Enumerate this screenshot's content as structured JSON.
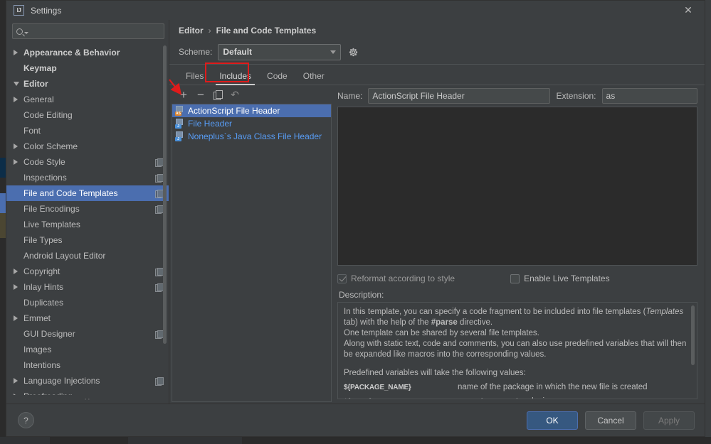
{
  "window": {
    "title": "Settings",
    "app_icon": "intellij-idea-icon",
    "close_icon": "close-icon"
  },
  "sidebar": {
    "search": {
      "placeholder": "",
      "value": "",
      "icon": "search-icon"
    },
    "items": [
      {
        "label": "Appearance & Behavior",
        "arrow": "collapsed",
        "bold": true,
        "indent": 0,
        "selected": false,
        "copy": false
      },
      {
        "label": "Keymap",
        "arrow": "none",
        "bold": true,
        "indent": 0,
        "selected": false,
        "copy": false
      },
      {
        "label": "Editor",
        "arrow": "expanded",
        "bold": true,
        "indent": 0,
        "selected": false,
        "copy": false
      },
      {
        "label": "General",
        "arrow": "collapsed",
        "bold": false,
        "indent": 1,
        "selected": false,
        "copy": false
      },
      {
        "label": "Code Editing",
        "arrow": "none",
        "bold": false,
        "indent": 1,
        "selected": false,
        "copy": false
      },
      {
        "label": "Font",
        "arrow": "none",
        "bold": false,
        "indent": 1,
        "selected": false,
        "copy": false
      },
      {
        "label": "Color Scheme",
        "arrow": "collapsed",
        "bold": false,
        "indent": 1,
        "selected": false,
        "copy": false
      },
      {
        "label": "Code Style",
        "arrow": "collapsed",
        "bold": false,
        "indent": 1,
        "selected": false,
        "copy": true
      },
      {
        "label": "Inspections",
        "arrow": "none",
        "bold": false,
        "indent": 1,
        "selected": false,
        "copy": true
      },
      {
        "label": "File and Code Templates",
        "arrow": "none",
        "bold": false,
        "indent": 1,
        "selected": true,
        "copy": true
      },
      {
        "label": "File Encodings",
        "arrow": "none",
        "bold": false,
        "indent": 1,
        "selected": false,
        "copy": true
      },
      {
        "label": "Live Templates",
        "arrow": "none",
        "bold": false,
        "indent": 1,
        "selected": false,
        "copy": false
      },
      {
        "label": "File Types",
        "arrow": "none",
        "bold": false,
        "indent": 1,
        "selected": false,
        "copy": false
      },
      {
        "label": "Android Layout Editor",
        "arrow": "none",
        "bold": false,
        "indent": 1,
        "selected": false,
        "copy": false
      },
      {
        "label": "Copyright",
        "arrow": "collapsed",
        "bold": false,
        "indent": 1,
        "selected": false,
        "copy": true
      },
      {
        "label": "Inlay Hints",
        "arrow": "collapsed",
        "bold": false,
        "indent": 1,
        "selected": false,
        "copy": true
      },
      {
        "label": "Duplicates",
        "arrow": "none",
        "bold": false,
        "indent": 1,
        "selected": false,
        "copy": false
      },
      {
        "label": "Emmet",
        "arrow": "collapsed",
        "bold": false,
        "indent": 1,
        "selected": false,
        "copy": false
      },
      {
        "label": "GUI Designer",
        "arrow": "none",
        "bold": false,
        "indent": 1,
        "selected": false,
        "copy": true
      },
      {
        "label": "Images",
        "arrow": "none",
        "bold": false,
        "indent": 1,
        "selected": false,
        "copy": false
      },
      {
        "label": "Intentions",
        "arrow": "none",
        "bold": false,
        "indent": 1,
        "selected": false,
        "copy": false
      },
      {
        "label": "Language Injections",
        "arrow": "collapsed",
        "bold": false,
        "indent": 1,
        "selected": false,
        "copy": true
      },
      {
        "label": "Proofreading",
        "arrow": "collapsed",
        "bold": false,
        "indent": 1,
        "selected": false,
        "copy": false
      }
    ]
  },
  "content": {
    "breadcrumb": {
      "parent": "Editor",
      "separator": "›",
      "current": "File and Code Templates"
    },
    "scheme": {
      "label": "Scheme:",
      "value": "Default",
      "gear_icon": "gear-icon",
      "dropdown_icon": "chevron-down-icon"
    },
    "tabs": [
      {
        "label": "Files",
        "active": false
      },
      {
        "label": "Includes",
        "active": true
      },
      {
        "label": "Code",
        "active": false
      },
      {
        "label": "Other",
        "active": false
      }
    ],
    "list_toolbar": [
      {
        "name": "add-template-button",
        "icon": "plus-icon",
        "glyph": "+"
      },
      {
        "name": "remove-template-button",
        "icon": "minus-icon",
        "glyph": "−"
      },
      {
        "name": "copy-template-button",
        "icon": "copy-icon",
        "glyph": ""
      },
      {
        "name": "reset-template-button",
        "icon": "revert-icon",
        "glyph": "↶"
      }
    ],
    "templates": [
      {
        "name": "ActionScript File Header",
        "badge": "AS",
        "badge_kind": "as",
        "selected": true
      },
      {
        "name": "File Header",
        "badge": "J",
        "badge_kind": "j",
        "selected": false
      },
      {
        "name": "Noneplus`s Java Class File Header",
        "badge": "J",
        "badge_kind": "j",
        "selected": false
      }
    ],
    "name_field": {
      "label": "Name:",
      "value": "ActionScript File Header"
    },
    "extension_field": {
      "label": "Extension:",
      "value": "as"
    },
    "editor": {
      "content": ""
    },
    "checkboxes": [
      {
        "label": "Reformat according to style",
        "checked": true,
        "disabled": true
      },
      {
        "label": "Enable Live Templates",
        "checked": false,
        "disabled": false
      }
    ],
    "description": {
      "label": "Description:",
      "line1_a": "In this template, you can specify a code fragment to be included into file templates (",
      "line1_it": "Templates",
      "line1_b": " tab) with the help of the ",
      "line1_bd": "#parse",
      "line1_c": " directive.",
      "line2": "One template can be shared by several file templates.",
      "line3": "Along with static text, code and comments, you can also use predefined variables that will then be expanded like macros into the corresponding values.",
      "line4": "Predefined variables will take the following values:",
      "variables": [
        {
          "name": "${PACKAGE_NAME}",
          "desc": "name of the package in which the new file is created"
        },
        {
          "name": "${USER}",
          "desc": "current user system login name"
        }
      ]
    }
  },
  "footer": {
    "help_label": "?",
    "buttons": [
      {
        "label": "OK",
        "style": "primary"
      },
      {
        "label": "Cancel",
        "style": "normal"
      },
      {
        "label": "Apply",
        "style": "disabled"
      }
    ]
  },
  "annotations": {
    "tab_highlight_color": "#e01b1b",
    "arrow_color": "#e01b1b",
    "highlighted_tab": "Includes",
    "arrow_target": "add-template-button"
  }
}
